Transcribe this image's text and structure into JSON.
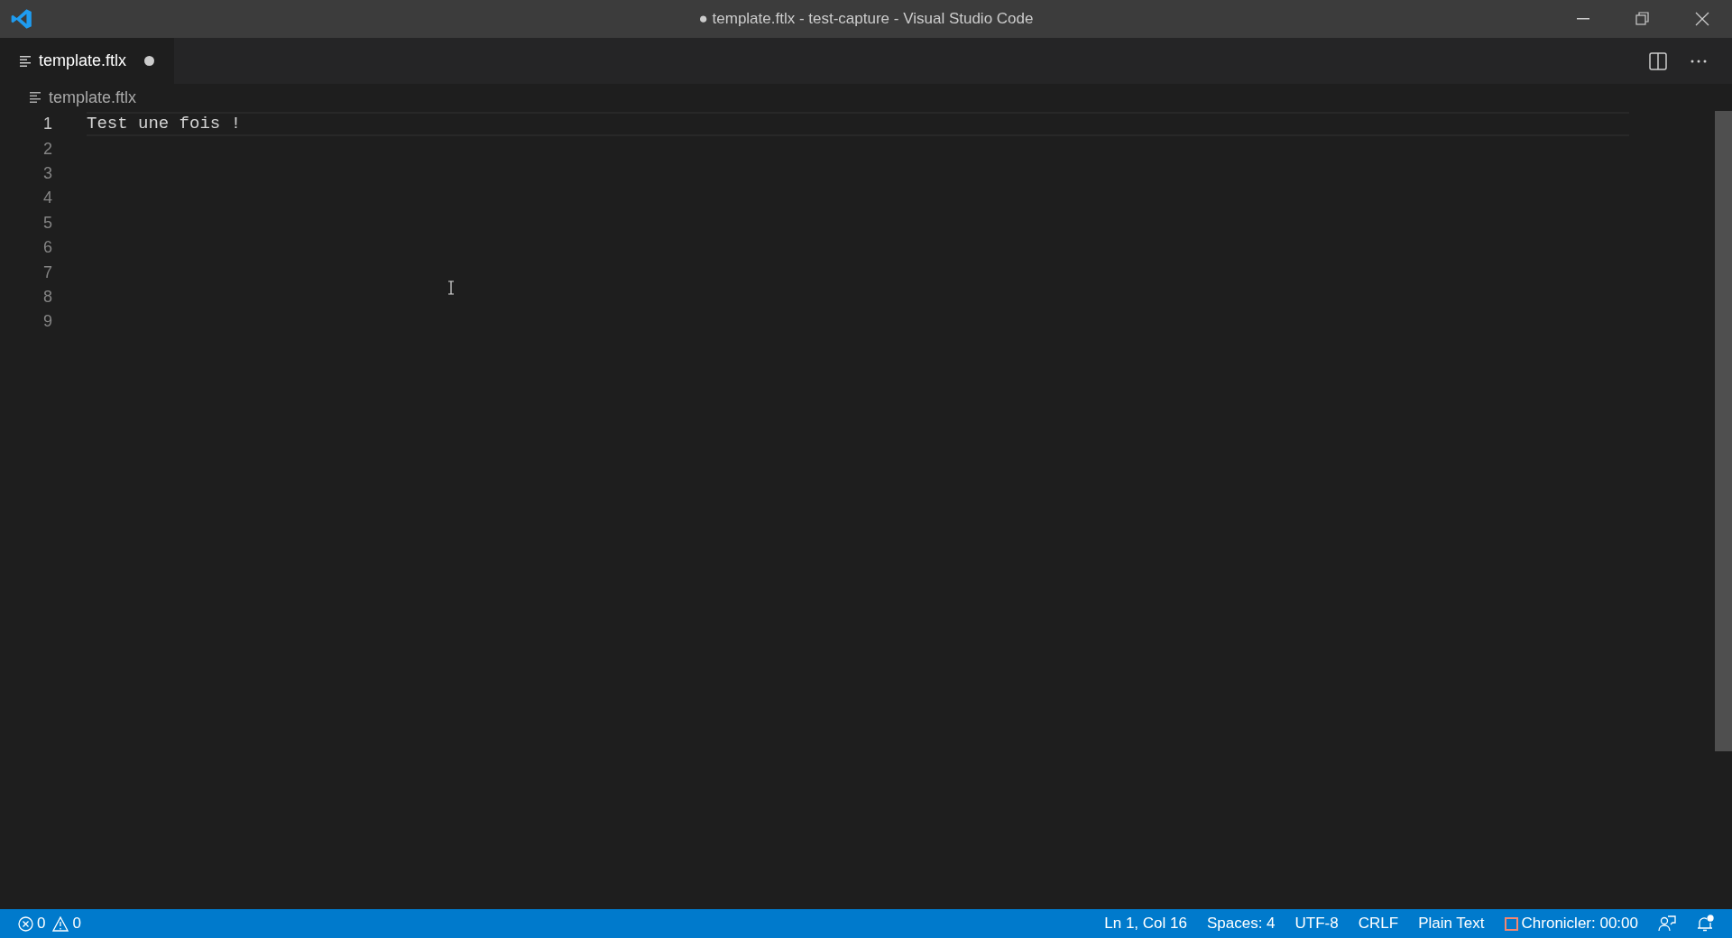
{
  "window": {
    "title": "● template.ftlx - test-capture - Visual Studio Code"
  },
  "tabs": [
    {
      "label": "template.ftlx",
      "selected": true,
      "modified": true
    }
  ],
  "breadcrumb": "template.ftlx",
  "editor": {
    "lines": [
      {
        "number": "1",
        "text": "Test une fois !",
        "current": true
      },
      {
        "number": "2",
        "current": false
      },
      {
        "number": "3",
        "current": false
      },
      {
        "number": "4",
        "current": false
      },
      {
        "number": "5",
        "current": false
      },
      {
        "number": "6",
        "current": false
      },
      {
        "number": "7",
        "current": false
      },
      {
        "number": "8",
        "current": false
      },
      {
        "number": "9",
        "current": false
      }
    ]
  },
  "status_bar": {
    "errors": "0",
    "warnings": "0",
    "items": [
      "Ln 1, Col 16",
      "Spaces: 4",
      "UTF-8",
      "CRLF",
      "Plain Text"
    ],
    "chronicler": "Chronicler: 00:00"
  }
}
